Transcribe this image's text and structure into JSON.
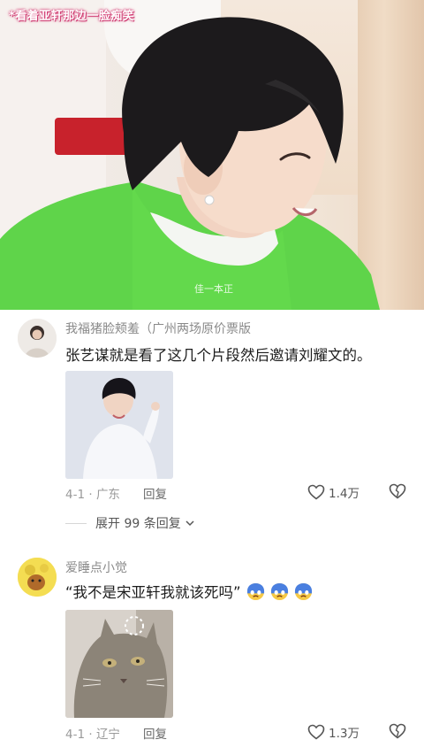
{
  "video": {
    "caption": "*看着亚轩那边一脸痴笑",
    "watermark": "佳一本正"
  },
  "comments": [
    {
      "username": "我福猪脸颊羞（广州两场原价票版",
      "text": "张艺谋就是看了这几个片段然后邀请刘耀文的。",
      "emojis": [],
      "date": "4-1",
      "location": "广东",
      "reply_label": "回复",
      "likes": "1.4万",
      "expand_label": "展开 99 条回复"
    },
    {
      "username": "爱睡点小觉",
      "text": "“我不是宋亚轩我就该死吗”",
      "emojis": [
        "crying-face-icon",
        "crying-face-icon",
        "crying-face-icon"
      ],
      "date": "4-1",
      "location": "辽宁",
      "reply_label": "回复",
      "likes": "1.3万"
    }
  ],
  "colors": {
    "caption_glow": "#d6457a",
    "shirt_green": "#5fd44a",
    "meta_gray": "#9a9a9a"
  }
}
